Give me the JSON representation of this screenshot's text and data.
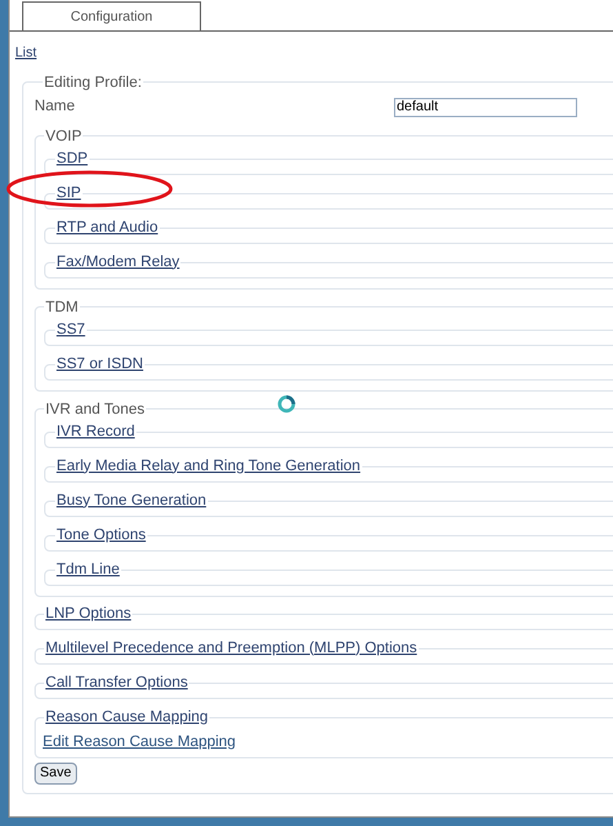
{
  "tab": {
    "label": "Configuration",
    "selected": true
  },
  "list_link": "List",
  "profile": {
    "legend": "Editing Profile:",
    "name_label": "Name",
    "name_value": "default",
    "sections": [
      {
        "kind": "group",
        "title": "VOIP",
        "items": [
          {
            "label": "SDP",
            "circled": false
          },
          {
            "label": "SIP",
            "circled": true
          },
          {
            "label": "RTP and Audio",
            "circled": false
          },
          {
            "label": "Fax/Modem Relay",
            "circled": false
          }
        ]
      },
      {
        "kind": "group",
        "title": "TDM",
        "items": [
          {
            "label": "SS7",
            "circled": false
          },
          {
            "label": "SS7 or ISDN",
            "circled": false
          }
        ]
      },
      {
        "kind": "group",
        "title": "IVR and Tones",
        "items": [
          {
            "label": "IVR Record",
            "circled": false
          },
          {
            "label": "Early Media Relay and Ring Tone Generation",
            "circled": false
          },
          {
            "label": "Busy Tone Generation",
            "circled": false
          },
          {
            "label": "Tone Options",
            "circled": false
          },
          {
            "label": "Tdm Line",
            "circled": false
          }
        ]
      },
      {
        "kind": "link",
        "title": "LNP Options"
      },
      {
        "kind": "link",
        "title": "Multilevel Precedence and Preemption (MLPP) Options"
      },
      {
        "kind": "link",
        "title": "Call Transfer Options"
      },
      {
        "kind": "mapping",
        "title": "Reason Cause Mapping",
        "link": "Edit Reason Cause Mapping"
      }
    ],
    "save": "Save"
  }
}
